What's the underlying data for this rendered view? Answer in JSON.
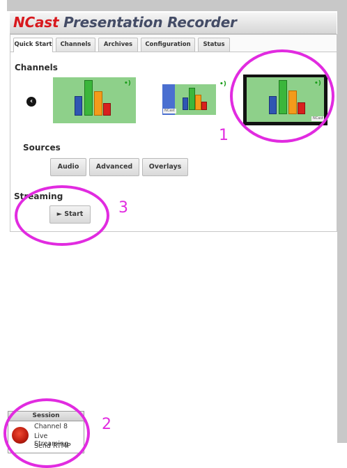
{
  "app": {
    "title_brand": "NCast",
    "title_rest": " Presentation Recorder"
  },
  "tabs": [
    "Quick Start",
    "Channels",
    "Archives",
    "Configuration",
    "Status"
  ],
  "channels": {
    "heading": "Channels",
    "nav_left_icon": "chevron-left-icon",
    "thumb_tag": "NCast"
  },
  "sources": {
    "heading": "Sources",
    "buttons": [
      "Audio",
      "Advanced",
      "Overlays"
    ]
  },
  "streaming": {
    "heading": "Streaming",
    "start_label": "► Start"
  },
  "annotations": {
    "n1": "1",
    "n2": "2",
    "n3": "3"
  },
  "session": {
    "header": "Session",
    "channel": "Channel 8",
    "status": "Live Streaming",
    "mode": "Send RTMP"
  },
  "colors": {
    "accent_magenta": "#e12be0",
    "brand_red": "#d8191e",
    "thumb_green": "#8ed08a"
  }
}
